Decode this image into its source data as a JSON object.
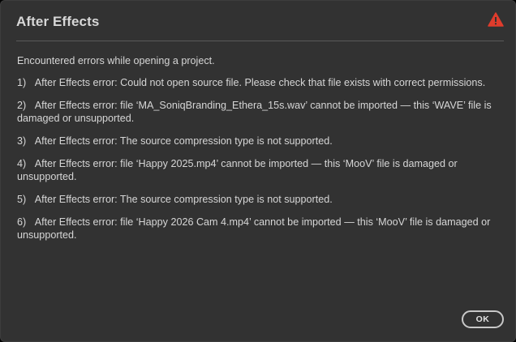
{
  "dialog": {
    "title": "After Effects",
    "icon": "warning-triangle-icon",
    "accent_color": "#e03c2c",
    "intro": "Encountered errors while opening a project.",
    "errors": [
      "1)   After Effects error: Could not open source file. Please check that file exists with correct permissions.",
      "2)   After Effects error: file ‘MA_SoniqBranding_Ethera_15s.wav’ cannot be imported — this ‘WAVE’ file is damaged or unsupported.",
      "3)   After Effects error: The source compression type is not supported.",
      "4)   After Effects error: file ‘Happy 2025.mp4’ cannot be imported — this ‘MooV’ file is damaged or unsupported.",
      "5)   After Effects error: The source compression type is not supported.",
      "6)   After Effects error: file ‘Happy 2026 Cam 4.mp4’ cannot be imported — this ‘MooV’ file is damaged or unsupported."
    ],
    "ok_label": "OK"
  }
}
